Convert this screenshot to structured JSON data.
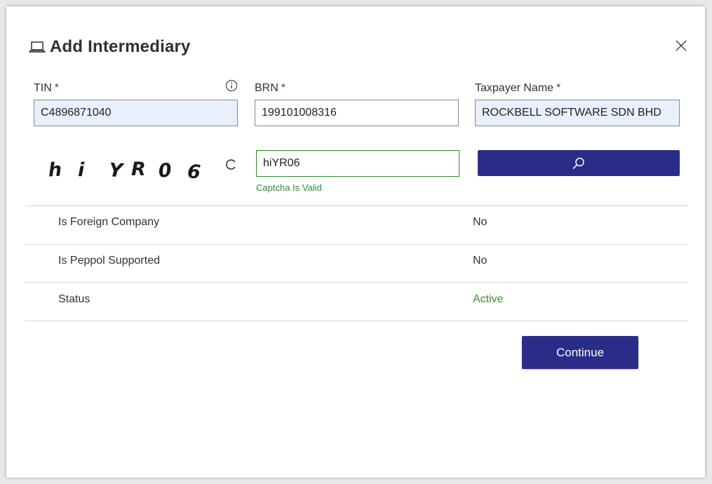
{
  "dialog": {
    "title": "Add Intermediary",
    "title_icon": "laptop-icon",
    "close_icon": "close-icon"
  },
  "fields": {
    "tin": {
      "label": "TIN",
      "required": "*",
      "value": "C4896871040",
      "info_icon": "info-icon"
    },
    "brn": {
      "label": "BRN",
      "required": "*",
      "value": "199101008316"
    },
    "taxpayer_name": {
      "label": "Taxpayer Name",
      "required": "*",
      "value": "ROCKBELL SOFTWARE SDN BHD"
    }
  },
  "captcha": {
    "image_text": "hi YR06",
    "refresh_icon": "refresh-icon",
    "value": "hiYR06",
    "status": "Captcha Is Valid",
    "search_icon": "search-icon"
  },
  "details": [
    {
      "label": "Is Foreign Company",
      "value": "No"
    },
    {
      "label": "Is Peppol Supported",
      "value": "No"
    },
    {
      "label": "Status",
      "value": "Active"
    }
  ],
  "colors": {
    "primary": "#2b2c87",
    "valid": "#2e8b2e",
    "required": "#a4262c",
    "autofill": "#e8f0fe"
  },
  "actions": {
    "continue_label": "Continue"
  }
}
